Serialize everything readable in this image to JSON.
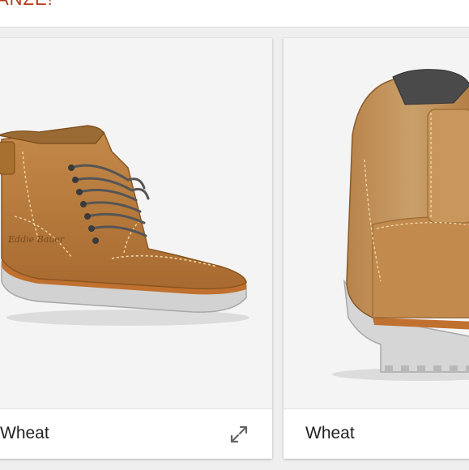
{
  "header": {
    "partial_text": "ANZE!",
    "accent_color": "#b5391a"
  },
  "cards": [
    {
      "image_icon": "boot-side-view",
      "color_label": "Wheat",
      "expand_icon": "expand-arrows-icon"
    },
    {
      "image_icon": "boot-back-view",
      "color_label": "Wheat"
    }
  ]
}
